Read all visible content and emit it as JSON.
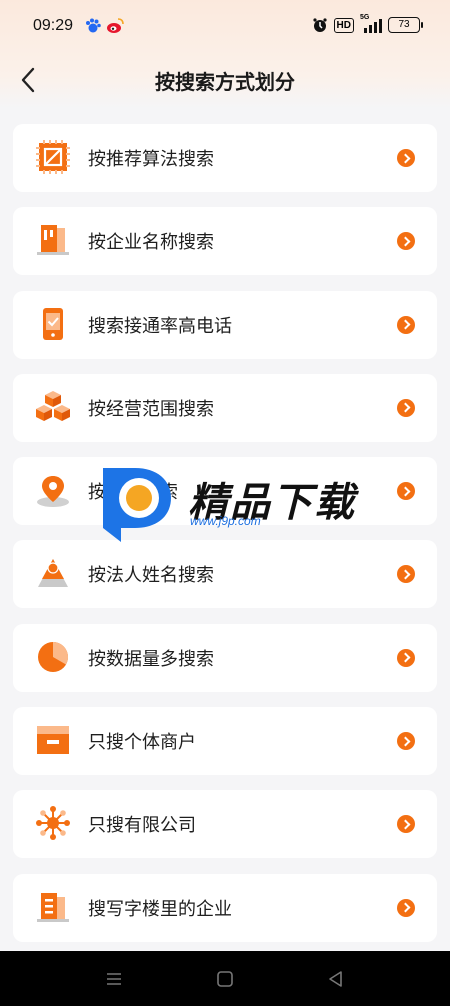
{
  "status_bar": {
    "time": "09:29",
    "network": "5G",
    "hd": "HD",
    "battery": "73"
  },
  "header": {
    "title": "按搜索方式划分"
  },
  "items": [
    {
      "label": "按推荐算法搜索",
      "icon": "algorithm-chip-icon"
    },
    {
      "label": "按企业名称搜索",
      "icon": "company-name-icon"
    },
    {
      "label": "搜索接通率高电话",
      "icon": "phone-icon"
    },
    {
      "label": "按经营范围搜索",
      "icon": "boxes-icon"
    },
    {
      "label": "按地址搜索",
      "icon": "location-pin-icon"
    },
    {
      "label": "按法人姓名搜索",
      "icon": "person-icon"
    },
    {
      "label": "按数据量多搜索",
      "icon": "pie-chart-icon"
    },
    {
      "label": "只搜个体商户",
      "icon": "shop-icon"
    },
    {
      "label": "只搜有限公司",
      "icon": "network-icon"
    },
    {
      "label": "搜写字楼里的企业",
      "icon": "building-icon"
    }
  ],
  "watermark": {
    "text": "精品下载",
    "url": "www.j9p.com"
  },
  "colors": {
    "accent": "#f36f12",
    "accent_light": "#fbb98a"
  }
}
